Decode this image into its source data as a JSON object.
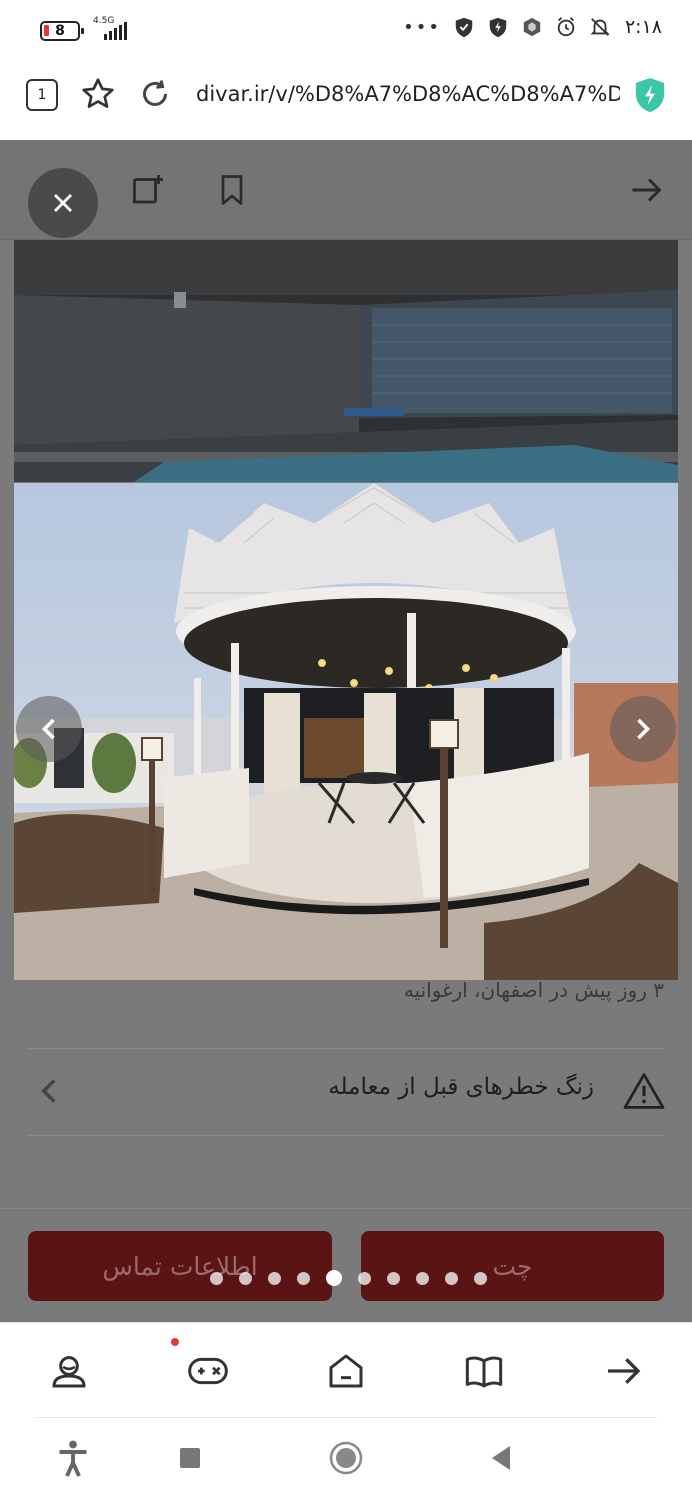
{
  "status_bar": {
    "battery_level": "8",
    "network_type": "4.5G",
    "overflow_dots": "•••",
    "time": "۲:۱۸"
  },
  "browser": {
    "tab_count": "1",
    "url": "divar.ir/v/%D8%A7%D8%AC%D8%A7%D",
    "icons": [
      "tabs-icon",
      "star-icon",
      "reload-icon",
      "shield-icon"
    ]
  },
  "page": {
    "top_icons": [
      "close-icon",
      "report-icon",
      "bookmark-icon",
      "forward-arrow-icon"
    ],
    "listing_meta": "۳ روز پیش در اصفهان، ارغوانیه",
    "warning_text": "زنگ خطرهای قبل از معامله",
    "contact_button": "اطلاعات تماس",
    "chat_button": "چت"
  },
  "gallery": {
    "total_images": 10,
    "active_index": 4,
    "nav": [
      "chevron-left-icon",
      "chevron-right-icon"
    ]
  },
  "bottom_nav": {
    "items": [
      "profile-icon",
      "games-icon",
      "home-icon",
      "reader-icon",
      "forward-icon"
    ],
    "notification_dot_color": "#e53935"
  },
  "colors": {
    "button_bg": "#5a1414",
    "dim_overlay": "#7a7a7a"
  }
}
